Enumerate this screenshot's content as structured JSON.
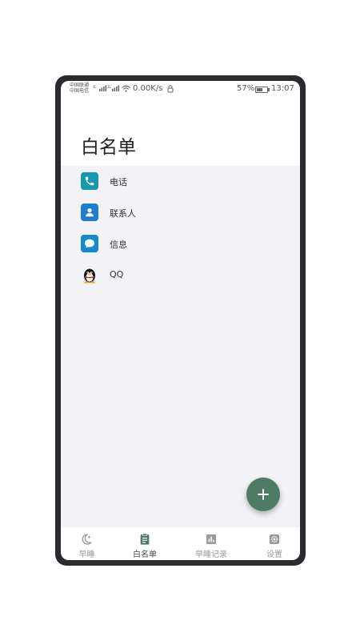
{
  "status_bar": {
    "carrier_1": "中国联通",
    "carrier_2": "中国电信",
    "signal_1_label": "4G",
    "signal_2_label": "2G",
    "net_speed": "0.00K/s",
    "battery": "57%",
    "time": "13:07"
  },
  "header": {
    "title": "白名单"
  },
  "whitelist": {
    "items": [
      {
        "label": "电话",
        "icon": "phone-icon"
      },
      {
        "label": "联系人",
        "icon": "contacts-icon"
      },
      {
        "label": "信息",
        "icon": "message-icon"
      },
      {
        "label": "QQ",
        "icon": "qq-icon"
      }
    ]
  },
  "fab": {
    "icon": "plus-icon"
  },
  "bottom_nav": {
    "items": [
      {
        "label": "早睡",
        "icon": "moon-icon",
        "active": false
      },
      {
        "label": "白名单",
        "icon": "clipboard-icon",
        "active": true
      },
      {
        "label": "早睡记录",
        "icon": "bar-chart-icon",
        "active": false
      },
      {
        "label": "设置",
        "icon": "gear-icon",
        "active": false
      }
    ]
  },
  "colors": {
    "accent": "#4f7a66",
    "active_nav_icon": "#4f7a66",
    "inactive_nav": "#9a9a9a",
    "list_background": "#f3f3f7"
  }
}
